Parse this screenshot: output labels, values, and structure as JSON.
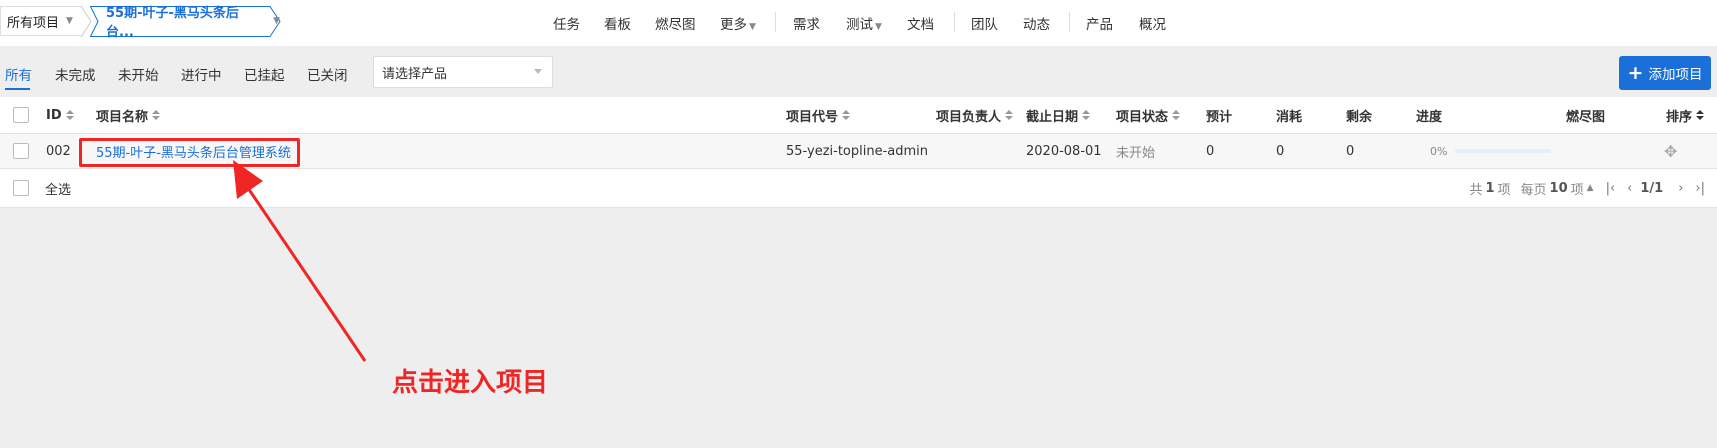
{
  "header": {
    "project_switch_label": "所有项目",
    "current_project": "55期-叶子-黑马头条后台...",
    "nav": {
      "task": "任务",
      "kanban": "看板",
      "burndown": "燃尽图",
      "more": "更多",
      "story": "需求",
      "test": "测试",
      "doc": "文档",
      "team": "团队",
      "dynamic": "动态",
      "product": "产品",
      "overview": "概况"
    }
  },
  "filters": {
    "tabs": [
      "所有",
      "未完成",
      "未开始",
      "进行中",
      "已挂起",
      "已关闭"
    ],
    "active_tab": "所有",
    "product_select": "请选择产品",
    "add_button": "添加项目"
  },
  "table": {
    "columns": {
      "id": "ID",
      "name": "项目名称",
      "code": "项目代号",
      "owner": "项目负责人",
      "end": "截止日期",
      "status": "项目状态",
      "estimate": "预计",
      "consumed": "消耗",
      "left": "剩余",
      "progress": "进度",
      "burn": "燃尽图",
      "order": "排序"
    },
    "rows": [
      {
        "id": "002",
        "name": "55期-叶子-黑马头条后台管理系统",
        "code": "55-yezi-topline-admin",
        "owner": "",
        "end": "2020-08-01",
        "status": "未开始",
        "estimate": "0",
        "consumed": "0",
        "left": "0",
        "progress": "0%"
      }
    ],
    "select_all": "全选",
    "pager": {
      "total_prefix": "共",
      "total": "1",
      "total_suffix": "项",
      "per_page_prefix": "每页",
      "per_page": "10",
      "per_page_suffix": "项",
      "page": "1/1"
    }
  },
  "annotation": {
    "text": "点击进入项目",
    "color": "#f02525"
  },
  "colors": {
    "accent": "#1a6fd8"
  }
}
